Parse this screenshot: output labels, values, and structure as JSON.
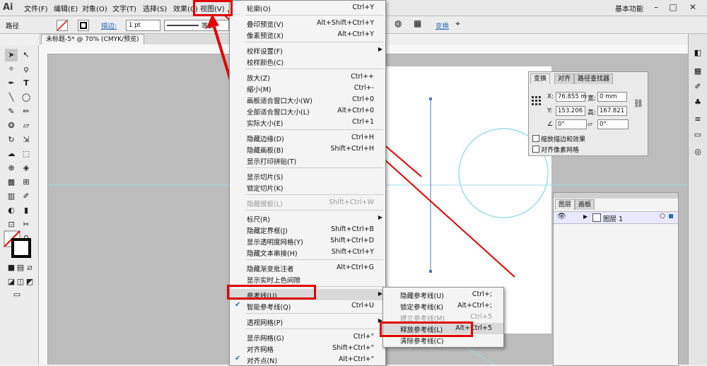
{
  "app": {
    "logo": "Ai",
    "workspace": "基本功能"
  },
  "menubar": {
    "items": [
      "文件(F)",
      "编辑(E)",
      "对象(O)",
      "文字(T)",
      "选择(S)",
      "效果(C)",
      "视图(V)"
    ]
  },
  "controlbar": {
    "path_label": "路径",
    "stroke_label": "描边:",
    "stroke_value": "1 pt",
    "profile_label": "等比",
    "transform_label": "变换"
  },
  "document": {
    "tab": "未标题-5* @ 70% (CMYK/预览)"
  },
  "view_menu": {
    "items": [
      {
        "label": "轮廓(O)",
        "shortcut": "Ctrl+Y"
      },
      {
        "label": "叠印预览(V)",
        "shortcut": "Alt+Shift+Ctrl+Y"
      },
      {
        "label": "像素预览(X)",
        "shortcut": "Alt+Ctrl+Y"
      },
      {
        "label": "校样设置(F)",
        "shortcut": ""
      },
      {
        "label": "校样颜色(C)",
        "shortcut": ""
      },
      {
        "label": "放大(Z)",
        "shortcut": "Ctrl++"
      },
      {
        "label": "缩小(M)",
        "shortcut": "Ctrl+-"
      },
      {
        "label": "画板适合窗口大小(W)",
        "shortcut": "Ctrl+0"
      },
      {
        "label": "全部适合窗口大小(L)",
        "shortcut": "Alt+Ctrl+0"
      },
      {
        "label": "实际大小(E)",
        "shortcut": "Ctrl+1"
      },
      {
        "label": "隐藏边缘(D)",
        "shortcut": "Ctrl+H"
      },
      {
        "label": "隐藏画板(B)",
        "shortcut": "Shift+Ctrl+H"
      },
      {
        "label": "显示打印拼贴(T)",
        "shortcut": ""
      },
      {
        "label": "显示切片(S)",
        "shortcut": ""
      },
      {
        "label": "锁定切片(K)",
        "shortcut": ""
      },
      {
        "label": "隐藏模板(L)",
        "shortcut": "Shift+Ctrl+W"
      },
      {
        "label": "标尺(R)",
        "shortcut": ""
      },
      {
        "label": "隐藏定界框(J)",
        "shortcut": "Shift+Ctrl+B"
      },
      {
        "label": "显示透明度网格(Y)",
        "shortcut": "Shift+Ctrl+D"
      },
      {
        "label": "隐藏文本串接(H)",
        "shortcut": "Shift+Ctrl+Y"
      },
      {
        "label": "隐藏渐变批注者",
        "shortcut": "Alt+Ctrl+G"
      },
      {
        "label": "显示实时上色间隙",
        "shortcut": ""
      },
      {
        "label": "参考线(U)",
        "shortcut": ""
      },
      {
        "label": "智能参考线(Q)",
        "shortcut": "Ctrl+U"
      },
      {
        "label": "透视网格(P)",
        "shortcut": ""
      },
      {
        "label": "显示网格(G)",
        "shortcut": "Ctrl+\""
      },
      {
        "label": "对齐网格",
        "shortcut": "Shift+Ctrl+\""
      },
      {
        "label": "对齐点(N)",
        "shortcut": "Alt+Ctrl+\""
      }
    ]
  },
  "guides_menu": {
    "items": [
      {
        "label": "隐藏参考线(U)",
        "shortcut": "Ctrl+;"
      },
      {
        "label": "锁定参考线(K)",
        "shortcut": "Alt+Ctrl+;"
      },
      {
        "label": "建立参考线(M)",
        "shortcut": "Ctrl+5"
      },
      {
        "label": "释放参考线(L)",
        "shortcut": "Alt+Ctrl+5"
      },
      {
        "label": "清除参考线(C)",
        "shortcut": ""
      }
    ]
  },
  "transform_panel": {
    "tabs": [
      "变换",
      "对齐",
      "路径查找器"
    ],
    "x_label": "X:",
    "x_value": "76.855 m",
    "w_label": "宽:",
    "w_value": "0 mm",
    "y_label": "Y:",
    "y_value": "153.206",
    "h_label": "高:",
    "h_value": "167.821",
    "rotate_value": "0°",
    "shear_value": "0°",
    "scale_strokes": "缩放描边和效果",
    "align_pixel": "对齐像素网格"
  },
  "layers_panel": {
    "tabs": [
      "图层",
      "画板"
    ],
    "layer_name": "图层 1"
  },
  "colors": {
    "highlight": "#e00000",
    "guide": "#9fdde8",
    "accent": "#2a6db5"
  }
}
